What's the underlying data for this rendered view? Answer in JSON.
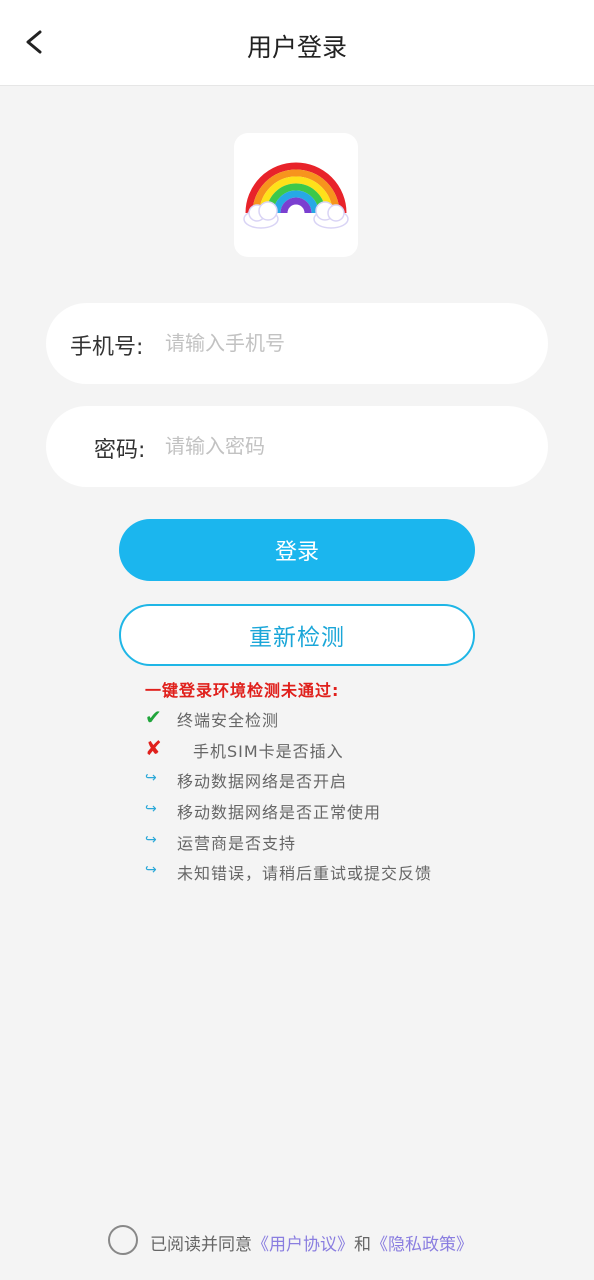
{
  "header": {
    "title": "用户登录"
  },
  "form": {
    "phone_label": "手机号:",
    "phone_placeholder": "请输入手机号",
    "password_label": "密码:",
    "password_placeholder": "请输入密码",
    "login_label": "登录",
    "recheck_label": "重新检测"
  },
  "check": {
    "title": "一键登录环境检测未通过:",
    "items": [
      {
        "status": "pass",
        "icon": "check-icon",
        "mark": "✔",
        "text": "终端安全检测"
      },
      {
        "status": "fail",
        "icon": "cross-icon",
        "mark": "✘",
        "text": "手机SIM卡是否插入"
      },
      {
        "status": "pending",
        "icon": "arrow-icon",
        "mark": "↪",
        "text": "移动数据网络是否开启"
      },
      {
        "status": "pending",
        "icon": "arrow-icon",
        "mark": "↪",
        "text": "移动数据网络是否正常使用"
      },
      {
        "status": "pending",
        "icon": "arrow-icon",
        "mark": "↪",
        "text": "运营商是否支持"
      },
      {
        "status": "pending",
        "icon": "arrow-icon",
        "mark": "↪",
        "text": "未知错误，请稍后重试或提交反馈"
      }
    ]
  },
  "agreement": {
    "prefix": "已阅读并同意",
    "user_agreement": "《用户协议》",
    "conjunction": "和",
    "privacy_policy": "《隐私政策》",
    "checked": false
  },
  "colors": {
    "primary": "#1bb6ee",
    "error": "#e0201c",
    "success": "#20a53b",
    "link": "#8a7ee0",
    "background": "#f4f4f4"
  }
}
